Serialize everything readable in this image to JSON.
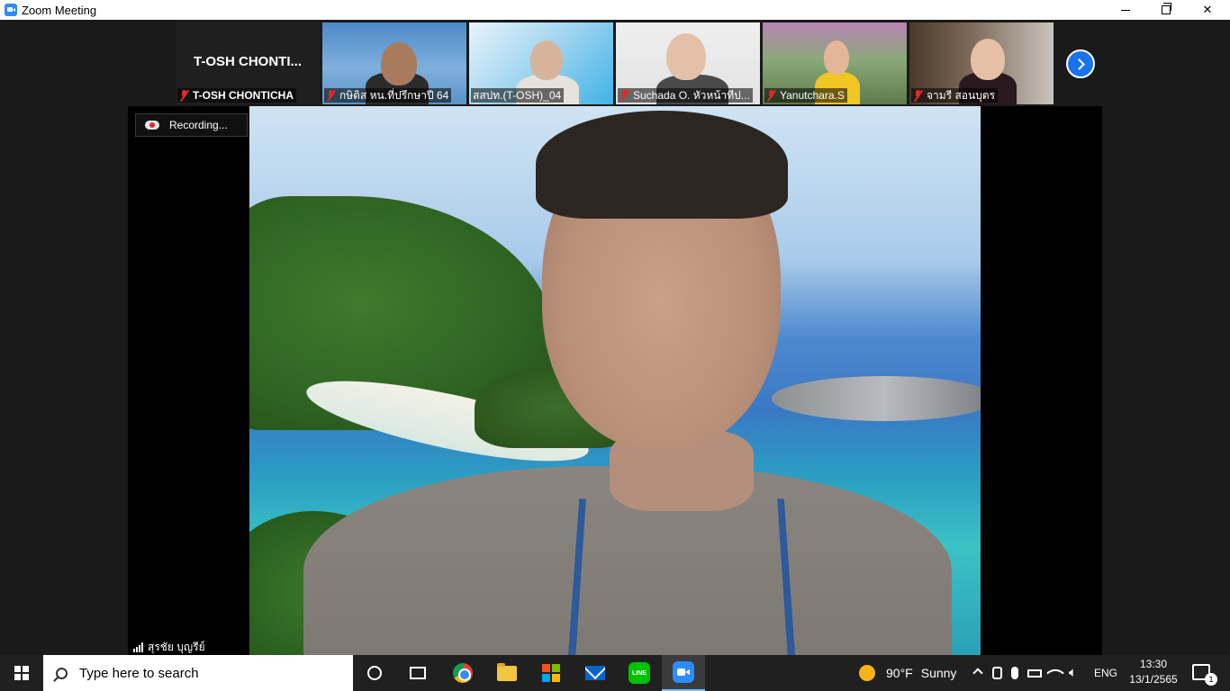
{
  "window": {
    "title": "Zoom Meeting"
  },
  "thumbnails": [
    {
      "display": "T-OSH  CHONTI...",
      "label": "T-OSH CHONTICHA"
    },
    {
      "label": "กษิติส  หน.ที่ปรึกษาปี 64"
    },
    {
      "label": "สสปท.(T-OSH)_04"
    },
    {
      "label": "Suchada O. หัวหน้าทีป..."
    },
    {
      "label": "Yanutchara.S"
    },
    {
      "label": "จามรี สอนบุตร"
    }
  ],
  "main": {
    "recording": "Recording...",
    "speaker_name": "สุรชัย บุญรีย์"
  },
  "taskbar": {
    "search_placeholder": "Type here to search",
    "weather": {
      "temp": "90°F",
      "condition": "Sunny"
    },
    "language": "ENG",
    "time": "13:30",
    "date": "13/1/2565",
    "notification_count": "1"
  },
  "colors": {
    "accent": "#2d8cff",
    "mic_muted": "#e02828",
    "taskbar": "#202020"
  }
}
